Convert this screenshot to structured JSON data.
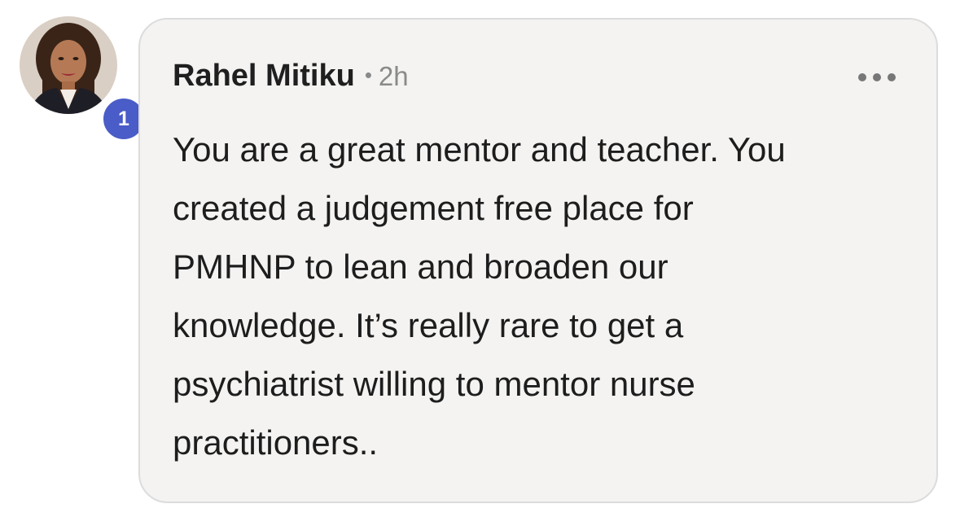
{
  "comment": {
    "author": "Rahel Mitiku",
    "separator": "•",
    "timestamp": "2h",
    "text": "You are a great mentor and teacher. You\ncreated a judgement free place for\nPMHNP to lean and broaden our\nknowledge. It’s really rare to get a\npsychiatrist willing to mentor nurse\npractitioners..",
    "more_icon": "more-horizontal-icon"
  },
  "avatar": {
    "badge_count": "1",
    "badge_color": "#4a5cc7"
  },
  "colors": {
    "bubble_background": "#f4f3f2",
    "bubble_border": "#dcdcdc",
    "text": "#1d1d1d",
    "muted": "#8a8a8a"
  }
}
